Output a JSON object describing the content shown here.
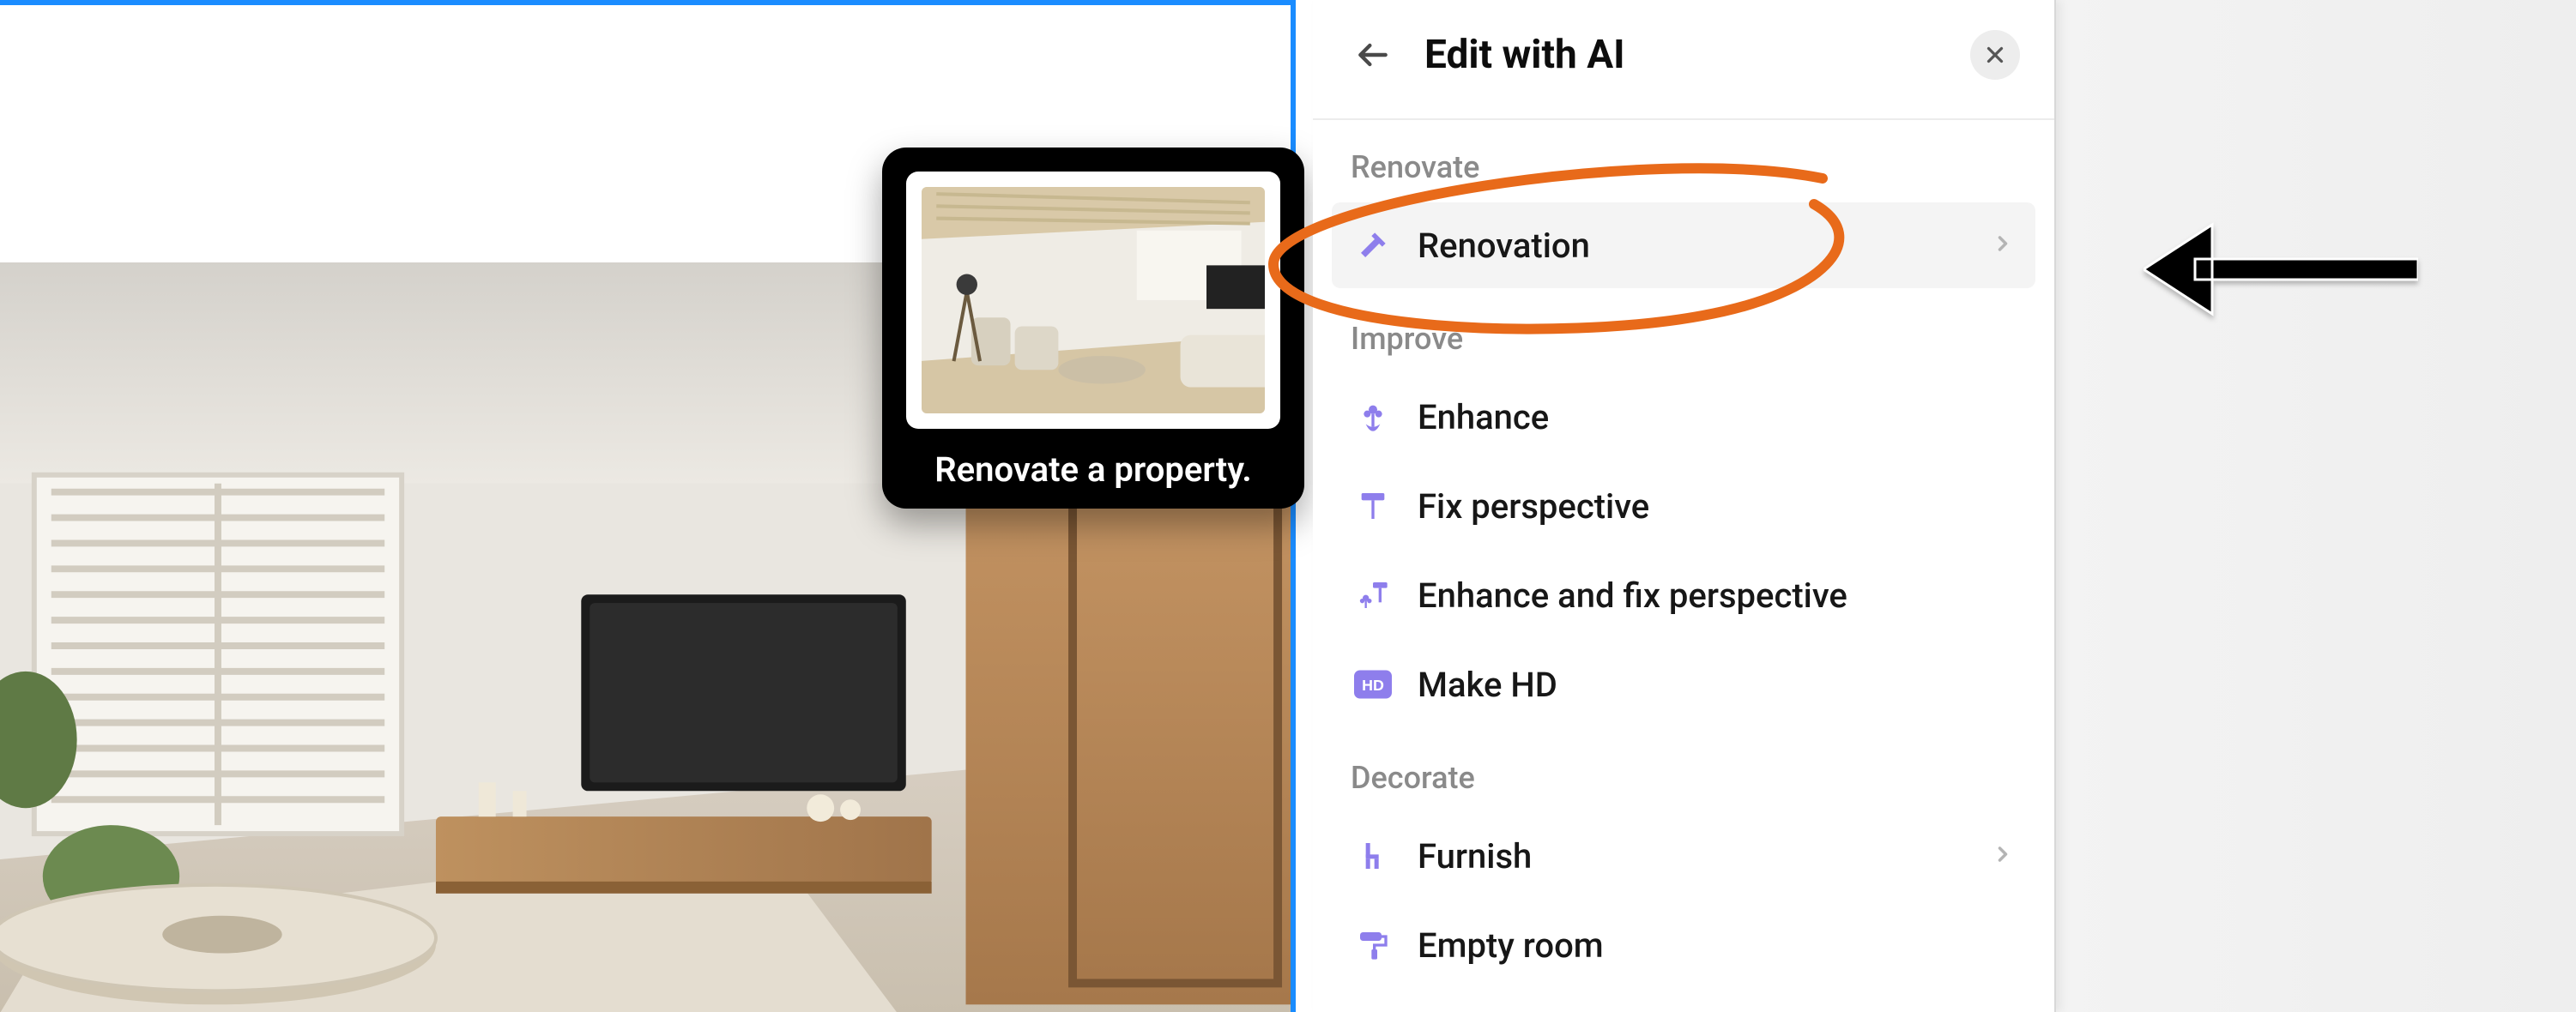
{
  "panel": {
    "title": "Edit with AI",
    "sections": {
      "renovate": {
        "label": "Renovate",
        "items": {
          "renovation": {
            "label": "Renovation"
          }
        }
      },
      "improve": {
        "label": "Improve",
        "items": {
          "enhance": {
            "label": "Enhance"
          },
          "fix_perspective": {
            "label": "Fix perspective"
          },
          "enhance_fix": {
            "label": "Enhance and fix perspective"
          },
          "make_hd": {
            "label": "Make HD"
          }
        }
      },
      "decorate": {
        "label": "Decorate",
        "items": {
          "furnish": {
            "label": "Furnish"
          },
          "empty_room": {
            "label": "Empty room"
          }
        }
      }
    }
  },
  "tooltip": {
    "text": "Renovate a property."
  },
  "colors": {
    "accent_purple": "#8e7eec",
    "selection_blue": "#1a8cff",
    "annotation_orange": "#e86a1a"
  }
}
